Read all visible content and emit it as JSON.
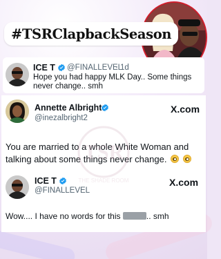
{
  "header": {
    "hashtag": "#TSRClapbackSeason"
  },
  "tweet1": {
    "name": "ICE T",
    "handle": "@FINALLEVEL",
    "time": "· 1d",
    "text_line1": "Hope you had happy MLK Day.. Some things",
    "text_line2": "never change.. smh"
  },
  "tweet2": {
    "name": "Annette Albright",
    "handle": "@inezalbright2",
    "platform": "X.com",
    "text_line1": "You are married to a whole White Woman and",
    "text_line2": "talking about some things never change."
  },
  "tweet3": {
    "name": "ICE T",
    "handle": "@FINALLEVEL",
    "platform": "X.com",
    "text_before": "Wow.... I have no words for this",
    "text_after": ".. smh"
  },
  "watermark": {
    "line1": "TSR",
    "line2": "THE SHADE ROOM"
  },
  "colors": {
    "verified": "#1d9bf0",
    "photo_border": "#d31f2d",
    "background": "#efe6f6"
  },
  "icons": {
    "verified": "verified-badge-icon",
    "x_logo": "x-logo-icon",
    "emoji": "flushed-face-emoji-icon"
  }
}
